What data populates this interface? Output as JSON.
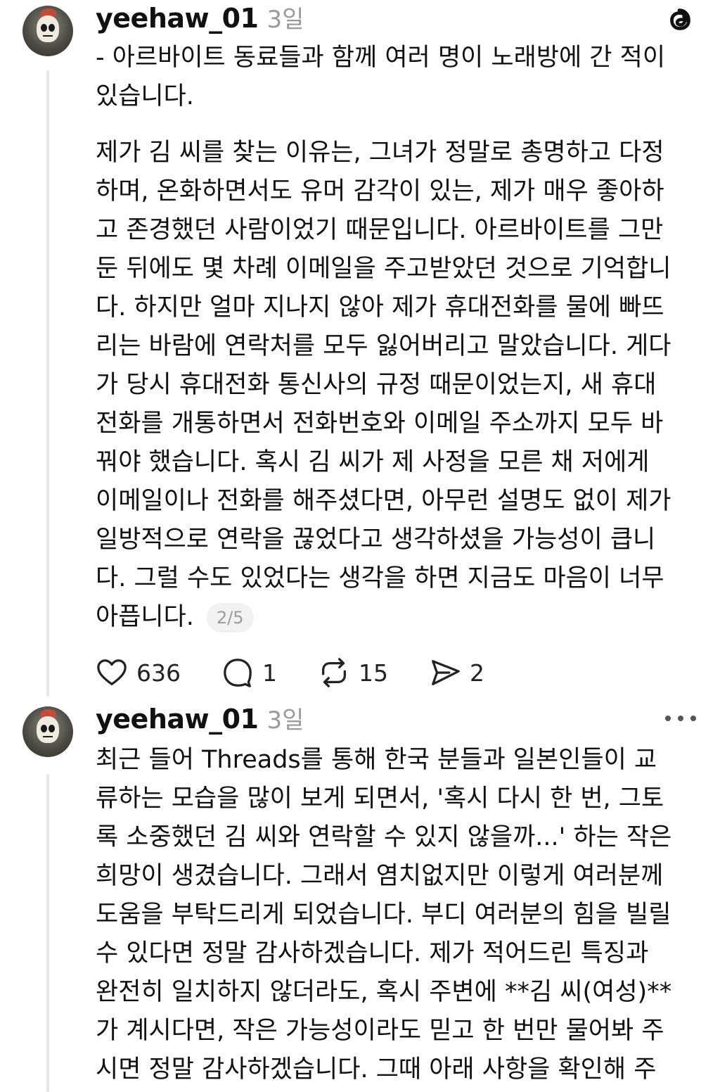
{
  "post1": {
    "username": "yeehaw_01",
    "time": "3일",
    "text_intro": "- 아르바이트 동료들과 함께 여러 명이 노래방에 간 적이\n있습니다.",
    "text_body": "제가 김 씨를 찾는 이유는, 그녀가 정말로 총명하고 다정\n하며, 온화하면서도 유머 감각이 있는, 제가 매우 좋아하\n고 존경했던 사람이었기 때문입니다. 아르바이트를 그만\n둔 뒤에도 몇 차례 이메일을 주고받았던 것으로 기억합니\n다. 하지만 얼마 지나지 않아 제가 휴대전화를 물에 빠뜨\n리는 바람에 연락처를 모두 잃어버리고 말았습니다. 게다\n가 당시 휴대전화 통신사의 규정 때문이었는지, 새 휴대\n전화를 개통하면서 전화번호와 이메일 주소까지 모두 바\n꿔야 했습니다. 혹시 김 씨가 제 사정을 모른 채 저에게\n이메일이나 전화를 해주셨다면, 아무런 설명도 없이 제가\n일방적으로 연락을 끊었다고 생각하셨을 가능성이 큽니\n다. 그럴 수도 있었다는 생각을 하면 지금도 마음이 너무\n아픕니다.",
    "page_indicator": "2/5",
    "likes": "636",
    "replies": "1",
    "reposts": "15",
    "shares": "2"
  },
  "post2": {
    "username": "yeehaw_01",
    "time": "3일",
    "text": "최근 들어 Threads를 통해 한국 분들과 일본인들이 교\n류하는 모습을 많이 보게 되면서, '혹시 다시 한 번, 그토\n록 소중했던 김 씨와 연락할 수 있지 않을까...' 하는 작은\n희망이 생겼습니다. 그래서 염치없지만 이렇게 여러분께\n도움을 부탁드리게 되었습니다. 부디 여러분의 힘을 빌릴\n수 있다면 정말 감사하겠습니다. 제가 적어드린 특징과\n완전히 일치하지 않더라도, 혹시 주변에 **김 씨(여성)**\n가 계시다면, 작은 가능성이라도 믿고 한 번만 물어봐 주\n시면 정말 감사하겠습니다. 그때 아래 사항을 확인해 주"
  },
  "icons": {
    "threads_logo": "threads-logo-icon",
    "like": "heart-icon",
    "reply": "comment-icon",
    "repost": "repost-icon",
    "share": "send-icon",
    "more": "more-icon"
  }
}
